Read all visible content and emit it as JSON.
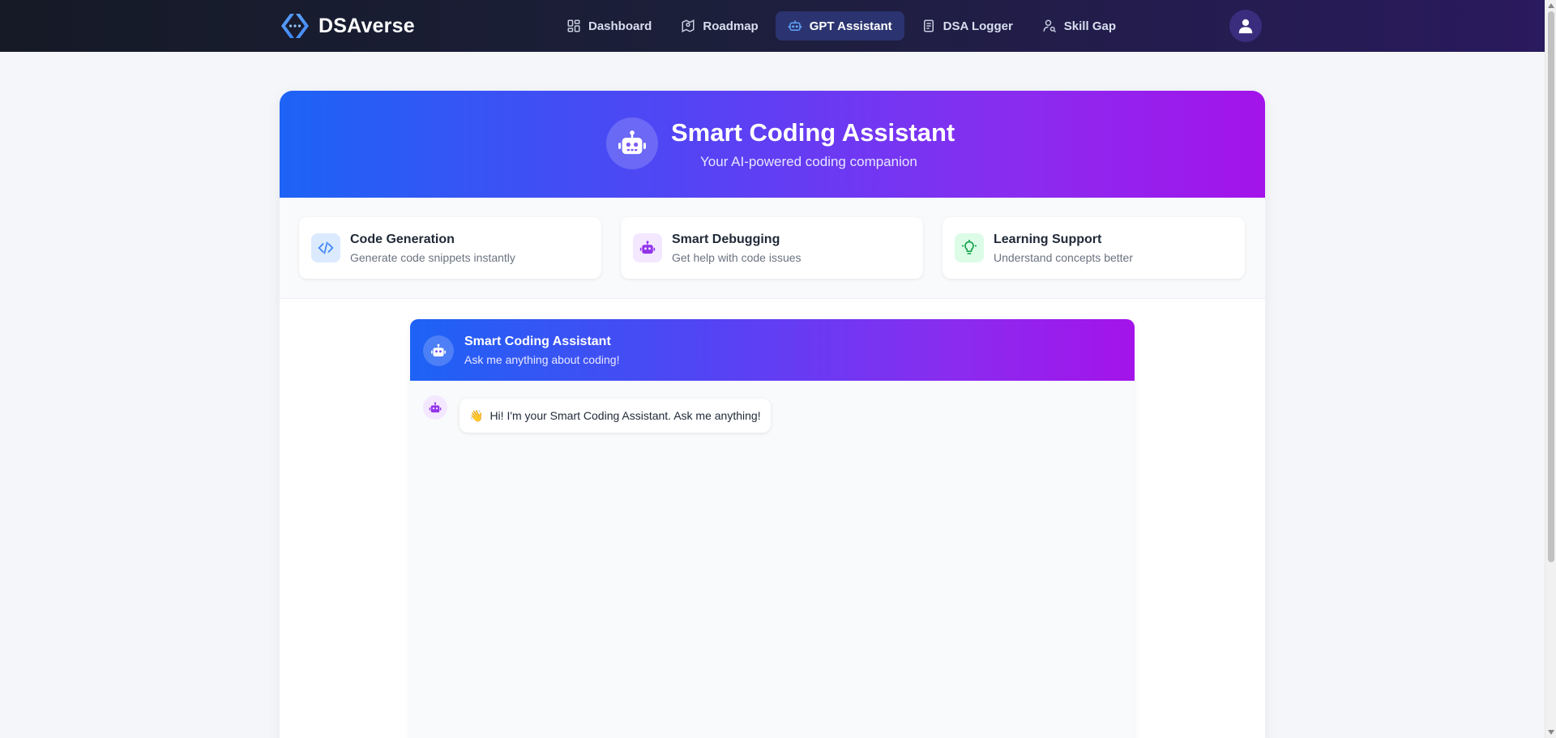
{
  "brand": {
    "name": "DSAverse",
    "logo_icon": "code-brackets-icon"
  },
  "nav": {
    "items": [
      {
        "label": "Dashboard",
        "icon": "grid-icon",
        "active": false
      },
      {
        "label": "Roadmap",
        "icon": "map-pin-icon",
        "active": false
      },
      {
        "label": "GPT Assistant",
        "icon": "robot-icon",
        "active": true
      },
      {
        "label": "DSA Logger",
        "icon": "document-icon",
        "active": false
      },
      {
        "label": "Skill Gap",
        "icon": "user-search-icon",
        "active": false
      }
    ]
  },
  "user": {
    "avatar_icon": "user-icon"
  },
  "hero": {
    "title": "Smart Coding Assistant",
    "subtitle": "Your AI-powered coding companion",
    "icon": "robot-icon"
  },
  "features": [
    {
      "title": "Code Generation",
      "desc": "Generate code snippets instantly",
      "icon": "code-icon",
      "color": "#3b82f6",
      "bg": "#dbeafe"
    },
    {
      "title": "Smart Debugging",
      "desc": "Get help with code issues",
      "icon": "robot-icon",
      "color": "#9333ea",
      "bg": "#f3e8ff"
    },
    {
      "title": "Learning Support",
      "desc": "Understand concepts better",
      "icon": "lightbulb-icon",
      "color": "#16a34a",
      "bg": "#dcfce7"
    }
  ],
  "chat": {
    "title": "Smart Coding Assistant",
    "subtitle": "Ask me anything about coding!",
    "messages": [
      {
        "sender": "assistant",
        "emoji": "👋",
        "text": "Hi! I'm your Smart Coding Assistant. Ask me anything!"
      }
    ]
  },
  "colors": {
    "accent": "#60a5fa",
    "gradient_start": "#1d63f5",
    "gradient_end": "#a313ea",
    "nav_active_bg": "#2b3470"
  }
}
